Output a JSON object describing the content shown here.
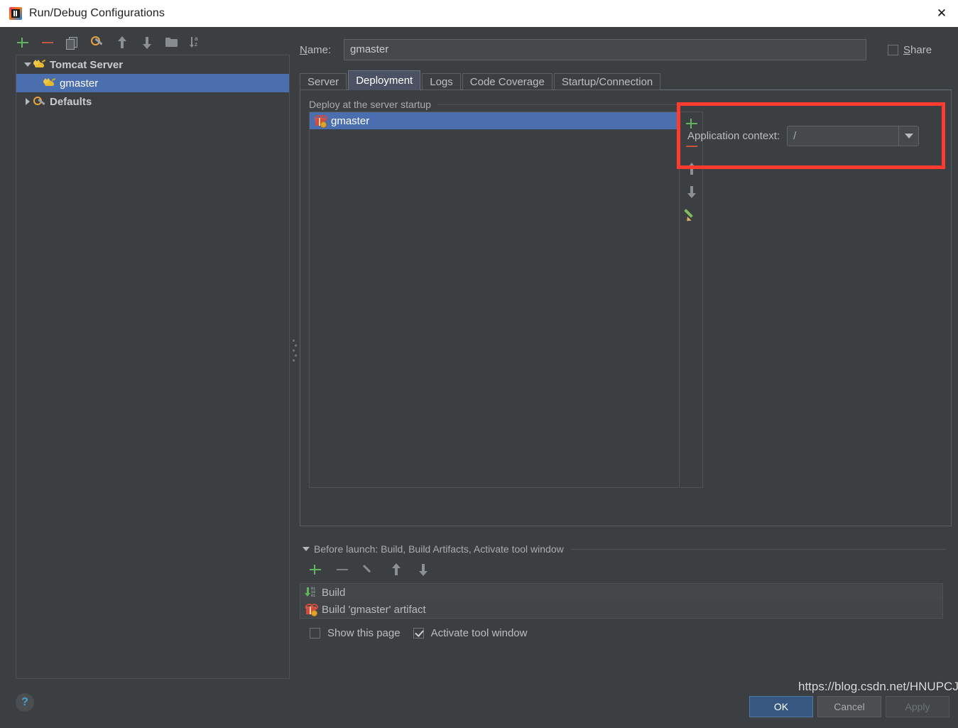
{
  "window": {
    "title": "Run/Debug Configurations",
    "app_icon": "intellij-idea-icon",
    "close_icon": "close-icon"
  },
  "sidebar": {
    "toolbar": [
      {
        "name": "add-configuration-button",
        "icon": "plus-icon"
      },
      {
        "name": "remove-configuration-button",
        "icon": "minus-icon"
      },
      {
        "name": "copy-configuration-button",
        "icon": "copy-icon"
      },
      {
        "name": "edit-defaults-button",
        "icon": "wrench-gear-icon"
      },
      {
        "name": "move-up-button",
        "icon": "arrow-up-icon"
      },
      {
        "name": "move-down-button",
        "icon": "arrow-down-icon"
      },
      {
        "name": "create-folder-button",
        "icon": "folder-icon"
      },
      {
        "name": "sort-configurations-button",
        "icon": "sort-az-icon"
      }
    ],
    "tree": [
      {
        "label": "Tomcat Server",
        "icon": "tomcat-icon",
        "expanded": true,
        "selected": false,
        "level": 0
      },
      {
        "label": "gmaster",
        "icon": "tomcat-icon",
        "expanded": null,
        "selected": true,
        "level": 1
      },
      {
        "label": "Defaults",
        "icon": "gear-icon",
        "expanded": false,
        "selected": false,
        "level": 0
      }
    ]
  },
  "main": {
    "name_label": "Name:",
    "name_value": "gmaster",
    "name_placeholder": "",
    "share_label": "Share",
    "share_checked": false,
    "tabs": [
      {
        "label": "Server",
        "active": false
      },
      {
        "label": "Deployment",
        "active": true
      },
      {
        "label": "Logs",
        "active": false
      },
      {
        "label": "Code Coverage",
        "active": false
      },
      {
        "label": "Startup/Connection",
        "active": false
      }
    ],
    "deployment": {
      "group_label": "Deploy at the server startup",
      "artifacts": [
        {
          "label": "gmaster",
          "icon": "artifact-icon",
          "selected": true
        }
      ],
      "list_toolbar": [
        {
          "name": "add-artifact-button",
          "icon": "plus-icon"
        },
        {
          "name": "remove-artifact-button",
          "icon": "minus-icon"
        },
        {
          "name": "move-artifact-up-button",
          "icon": "arrow-up-icon"
        },
        {
          "name": "move-artifact-down-button",
          "icon": "arrow-down-icon"
        },
        {
          "name": "edit-artifact-button",
          "icon": "pencil-icon"
        }
      ],
      "application_context_label": "Application context:",
      "application_context_value": "/",
      "highlight_color": "#ff3b30"
    }
  },
  "before_launch": {
    "header": "Before launch: Build, Build Artifacts, Activate tool window",
    "toolbar": [
      {
        "name": "add-task-button",
        "icon": "plus-icon"
      },
      {
        "name": "remove-task-button",
        "icon": "minus-icon"
      },
      {
        "name": "edit-task-button",
        "icon": "pencil-icon"
      },
      {
        "name": "move-task-up-button",
        "icon": "arrow-up-icon"
      },
      {
        "name": "move-task-down-button",
        "icon": "arrow-down-icon"
      }
    ],
    "tasks": [
      {
        "label": "Build",
        "icon": "build-icon"
      },
      {
        "label": "Build 'gmaster' artifact",
        "icon": "artifact-icon"
      }
    ],
    "show_this_page_label": "Show this page",
    "show_this_page_checked": false,
    "activate_tool_window_label": "Activate tool window",
    "activate_tool_window_checked": true
  },
  "footer": {
    "help_icon": "help-question-icon",
    "ok_label": "OK",
    "cancel_label": "Cancel",
    "apply_label": "Apply",
    "apply_disabled": true,
    "primary_color": "#365880"
  },
  "watermark": {
    "text": "https://blog.csdn.net/HNUPCJ"
  }
}
